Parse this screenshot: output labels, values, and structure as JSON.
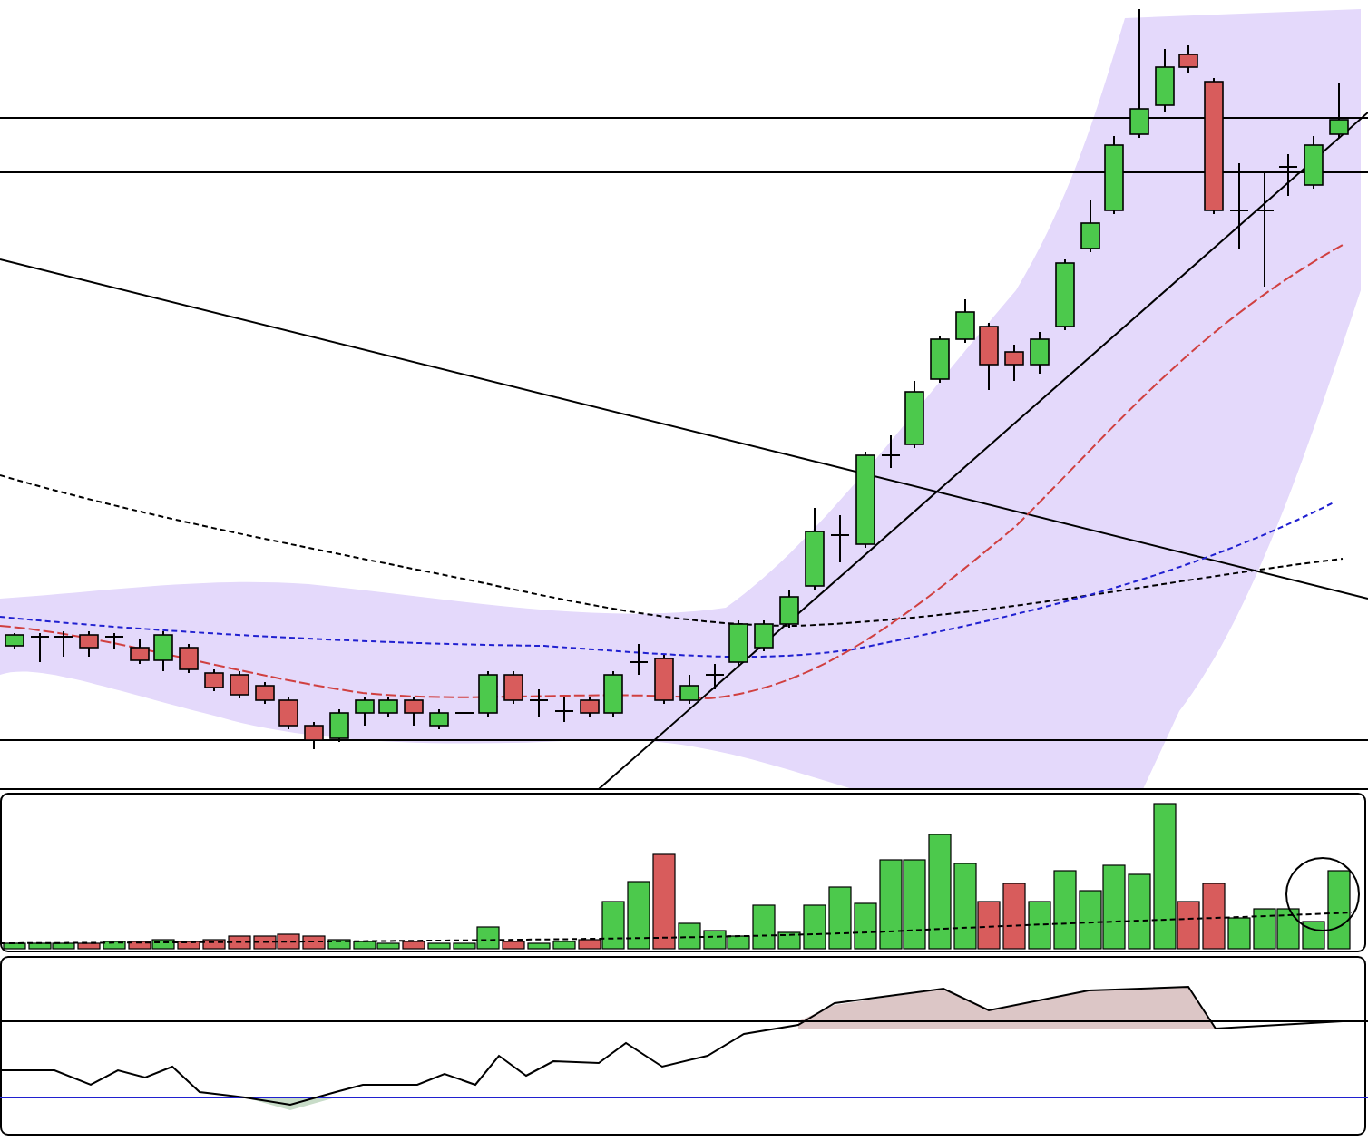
{
  "panels": [
    {
      "kind": "price"
    },
    {
      "kind": "volume"
    },
    {
      "kind": "oscillator"
    }
  ]
}
